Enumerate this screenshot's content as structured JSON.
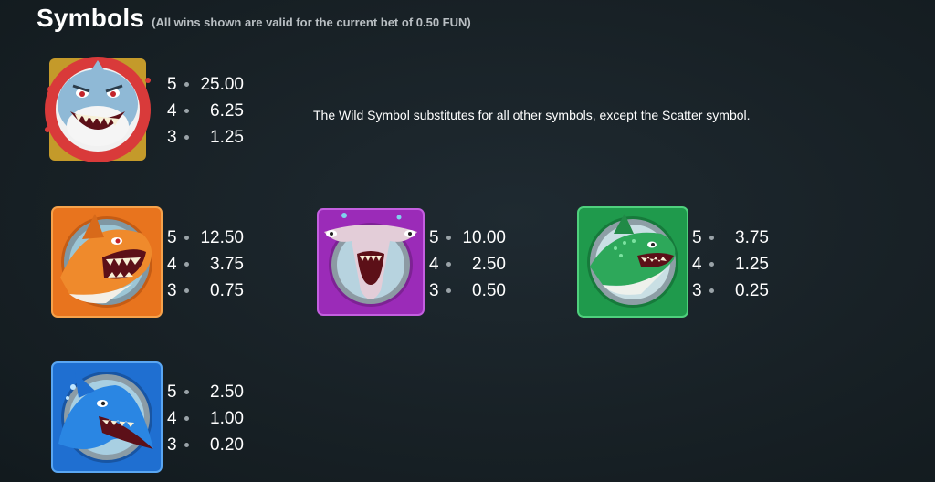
{
  "header": {
    "title": "Symbols",
    "subtitle": "(All wins shown are valid for the current bet of 0.50 FUN)"
  },
  "note": "The Wild Symbol substitutes for all other symbols, except the Scatter symbol.",
  "symbols": [
    {
      "icon": "wild-shark-icon",
      "payouts": [
        {
          "count": "5",
          "value": "25.00"
        },
        {
          "count": "4",
          "value": "6.25"
        },
        {
          "count": "3",
          "value": "1.25"
        }
      ]
    },
    {
      "icon": "orange-shark-icon",
      "payouts": [
        {
          "count": "5",
          "value": "12.50"
        },
        {
          "count": "4",
          "value": "3.75"
        },
        {
          "count": "3",
          "value": "0.75"
        }
      ]
    },
    {
      "icon": "purple-hammerhead-icon",
      "payouts": [
        {
          "count": "5",
          "value": "10.00"
        },
        {
          "count": "4",
          "value": "2.50"
        },
        {
          "count": "3",
          "value": "0.50"
        }
      ]
    },
    {
      "icon": "green-shark-icon",
      "payouts": [
        {
          "count": "5",
          "value": "3.75"
        },
        {
          "count": "4",
          "value": "1.25"
        },
        {
          "count": "3",
          "value": "0.25"
        }
      ]
    },
    {
      "icon": "blue-shark-icon",
      "payouts": [
        {
          "count": "5",
          "value": "2.50"
        },
        {
          "count": "4",
          "value": "1.00"
        },
        {
          "count": "3",
          "value": "0.20"
        }
      ]
    }
  ],
  "colors": {
    "orange": "#e8741e",
    "purple": "#9b2bb8",
    "green": "#1f9a4c",
    "blue": "#1f6fd1",
    "wild_ring": "#d93a3a"
  }
}
